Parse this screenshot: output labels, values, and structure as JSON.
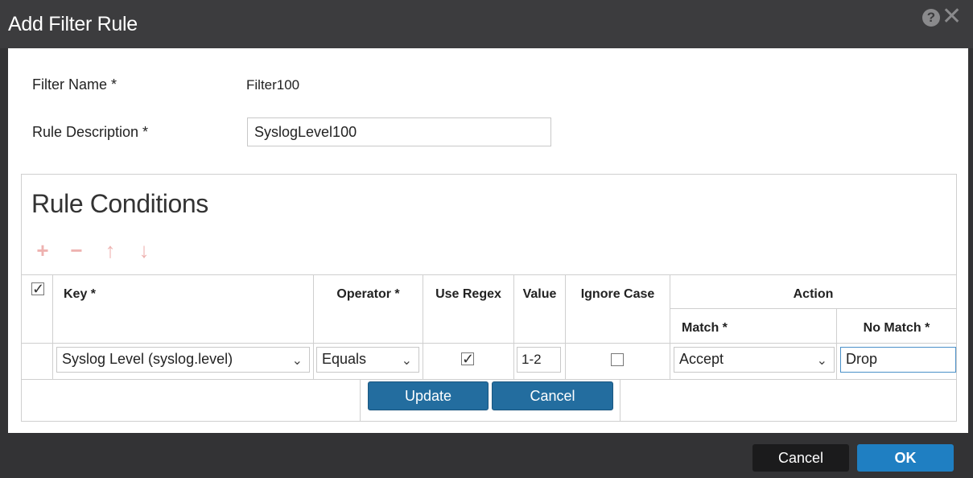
{
  "dialog": {
    "title": "Add Filter Rule",
    "help_glyph": "?",
    "close_glyph": "✕"
  },
  "form": {
    "filter_name_label": "Filter Name *",
    "filter_name_value": "Filter100",
    "rule_description_label": "Rule Description *",
    "rule_description_value": "SyslogLevel100"
  },
  "conditions": {
    "title": "Rule Conditions",
    "toolbar": {
      "add_glyph": "+",
      "remove_glyph": "−",
      "move_up_glyph": "↑",
      "move_down_glyph": "↓"
    },
    "headers": {
      "key": "Key *",
      "operator": "Operator *",
      "use_regex": "Use Regex",
      "value": "Value",
      "ignore_case": "Ignore Case",
      "action": "Action",
      "match": "Match *",
      "no_match": "No Match *"
    },
    "row": {
      "key": "Syslog Level (syslog.level)",
      "operator": "Equals",
      "use_regex_checked": true,
      "value": "1-2",
      "ignore_case_checked": false,
      "match": "Accept",
      "no_match": "Drop"
    },
    "update_label": "Update",
    "cancel_label": "Cancel"
  },
  "footer": {
    "cancel_label": "Cancel",
    "ok_label": "OK"
  },
  "colors": {
    "titlebar": "#3c3c3e",
    "footer": "#333335",
    "primary_button": "#1f7fc2",
    "row_button": "#236d9f",
    "toolbar_icons": "#eeb2b0"
  }
}
